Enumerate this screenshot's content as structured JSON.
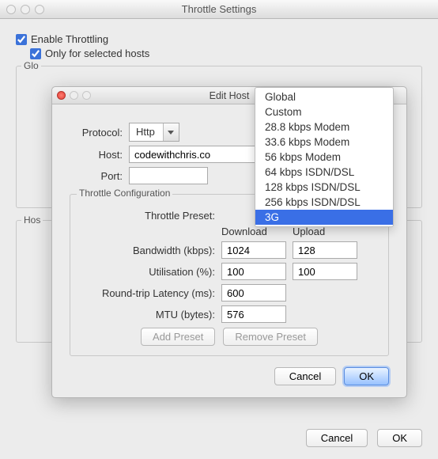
{
  "window": {
    "title": "Throttle Settings",
    "enable_label": "Enable Throttling",
    "only_hosts_label": "Only for selected hosts",
    "group_global": "Glo",
    "group_hosts": "Hos",
    "cancel": "Cancel",
    "ok": "OK"
  },
  "modal": {
    "title": "Edit Host",
    "protocol_label": "Protocol:",
    "protocol_value": "Http",
    "host_label": "Host:",
    "host_value": "codewithchris.co",
    "port_label": "Port:",
    "port_value": "",
    "config": {
      "group_label": "Throttle Configuration",
      "preset_label": "Throttle Preset:",
      "col_download": "Download",
      "col_upload": "Upload",
      "bandwidth_label": "Bandwidth (kbps):",
      "bandwidth_dl": "1024",
      "bandwidth_ul": "128",
      "utilisation_label": "Utilisation (%):",
      "utilisation_dl": "100",
      "utilisation_ul": "100",
      "latency_label": "Round-trip Latency (ms):",
      "latency_val": "600",
      "mtu_label": "MTU (bytes):",
      "mtu_val": "576",
      "add_preset": "Add Preset",
      "remove_preset": "Remove Preset"
    },
    "cancel": "Cancel",
    "ok": "OK"
  },
  "dropdown": {
    "items": [
      "Global",
      "Custom",
      "28.8 kbps Modem",
      "33.6 kbps Modem",
      "56 kbps Modem",
      "64 kbps ISDN/DSL",
      "128 kbps ISDN/DSL",
      "256 kbps ISDN/DSL",
      "3G"
    ],
    "selected_index": 8
  }
}
